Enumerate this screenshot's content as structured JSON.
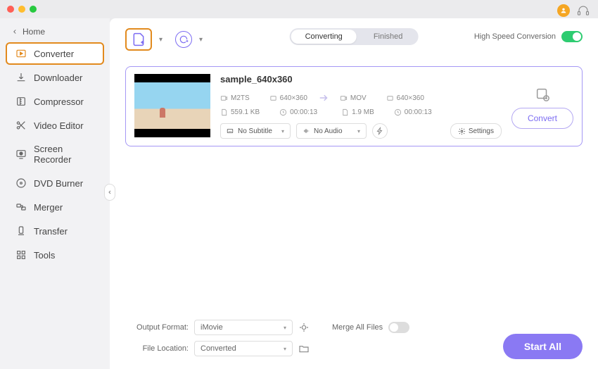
{
  "sidebar": {
    "home": "Home",
    "items": [
      {
        "label": "Converter"
      },
      {
        "label": "Downloader"
      },
      {
        "label": "Compressor"
      },
      {
        "label": "Video Editor"
      },
      {
        "label": "Screen Recorder"
      },
      {
        "label": "DVD Burner"
      },
      {
        "label": "Merger"
      },
      {
        "label": "Transfer"
      },
      {
        "label": "Tools"
      }
    ]
  },
  "toolbar": {
    "tabs": {
      "converting": "Converting",
      "finished": "Finished"
    },
    "high_speed_label": "High Speed Conversion"
  },
  "file": {
    "name": "sample_640x360",
    "src": {
      "format": "M2TS",
      "res": "640×360",
      "size": "559.1 KB",
      "dur": "00:00:13"
    },
    "dst": {
      "format": "MOV",
      "res": "640×360",
      "size": "1.9 MB",
      "dur": "00:00:13"
    },
    "subtitle": "No Subtitle",
    "audio": "No Audio",
    "settings_label": "Settings",
    "convert_label": "Convert"
  },
  "footer": {
    "output_format_label": "Output Format:",
    "output_format_value": "iMovie",
    "file_location_label": "File Location:",
    "file_location_value": "Converted",
    "merge_label": "Merge All Files",
    "start_all": "Start All"
  }
}
